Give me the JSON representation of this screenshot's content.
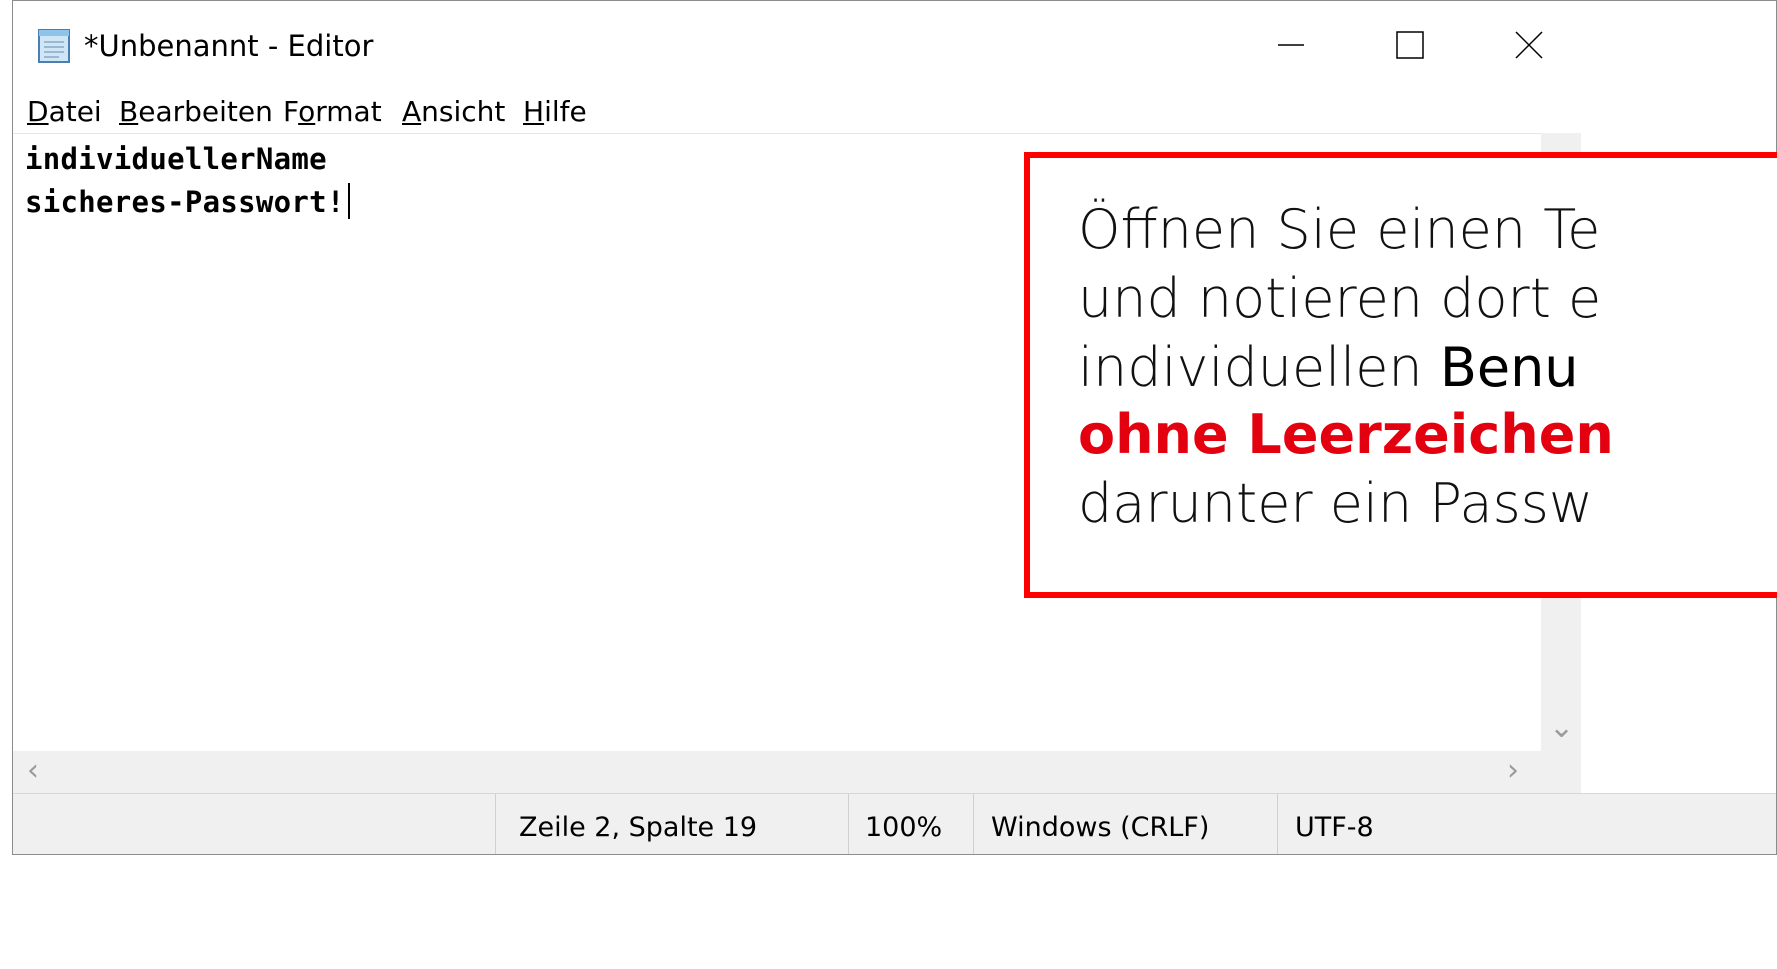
{
  "window": {
    "title": "*Unbenannt - Editor",
    "icon": "notepad-icon"
  },
  "titlebar_buttons": {
    "minimize": "minimize-icon",
    "maximize": "maximize-icon",
    "close": "close-icon"
  },
  "menu": {
    "items": [
      {
        "accel": "D",
        "rest": "atei",
        "pre": ""
      },
      {
        "accel": "B",
        "rest": "earbeiten",
        "pre": ""
      },
      {
        "accel": "o",
        "rest": "rmat",
        "pre": "F"
      },
      {
        "accel": "A",
        "rest": "nsicht",
        "pre": ""
      },
      {
        "accel": "H",
        "rest": "ilfe",
        "pre": ""
      }
    ]
  },
  "editor": {
    "lines": [
      "individuellerName",
      "sicheres-Passwort!"
    ]
  },
  "status": {
    "position": "Zeile 2, Spalte 19",
    "zoom": "100%",
    "line_ending": "Windows (CRLF)",
    "encoding": "UTF-8"
  },
  "callout": {
    "line1": "Öffnen Sie einen Te",
    "line2": "und notieren dort e",
    "line3_a": "individuellen ",
    "line3_b": "Benu",
    "line4": "ohne Leerzeichen",
    "line5": "darunter ein Passw",
    "border_color": "#ff0000",
    "emphasis_color": "#e3000f"
  }
}
